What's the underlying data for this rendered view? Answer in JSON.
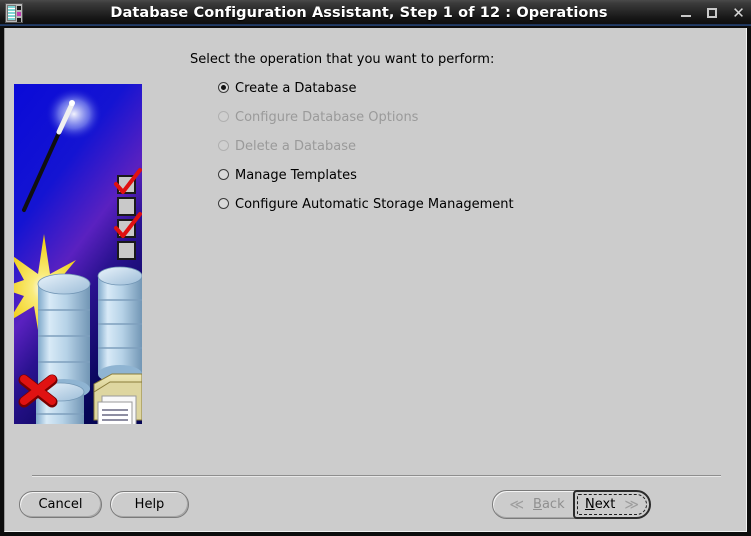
{
  "window": {
    "title": "Database Configuration Assistant, Step 1 of 12 : Operations",
    "icon": "database-app-icon",
    "controls": {
      "minimize": "minimize-icon",
      "maximize": "maximize-icon",
      "close": "close-icon",
      "close_glyph": "✕"
    },
    "colors": {
      "titlebar_start": "#4a4a4a",
      "titlebar_end": "#0c0c0c",
      "accent_underline": "#24406e",
      "dialog_background": "#cccccc",
      "artwork_background": "#0000bb",
      "disabled_text": "#9a9a9a"
    }
  },
  "main": {
    "prompt": "Select the operation that you want to perform:",
    "options": [
      {
        "label": "Create a Database",
        "selected": true,
        "enabled": true
      },
      {
        "label": "Configure Database Options",
        "selected": false,
        "enabled": false
      },
      {
        "label": "Delete a Database",
        "selected": false,
        "enabled": false
      },
      {
        "label": "Manage Templates",
        "selected": false,
        "enabled": true
      },
      {
        "label": "Configure Automatic Storage Management",
        "selected": false,
        "enabled": true
      }
    ]
  },
  "artwork": {
    "name": "dbca-splash-graphic",
    "elements": [
      "magic-wand-icon",
      "sparkle-star-icon",
      "database-cylinder-icon",
      "checklist-icon",
      "red-x-icon",
      "folder-documents-icon"
    ]
  },
  "footer": {
    "cancel_label": "Cancel",
    "help_label": "Help",
    "back": {
      "label": "Back",
      "mnemonic": "B",
      "rest": "ack",
      "chevron": "≪",
      "enabled": false
    },
    "next": {
      "label": "Next",
      "mnemonic": "N",
      "rest": "ext",
      "chevron": "≫",
      "enabled": true,
      "focused": true
    }
  }
}
